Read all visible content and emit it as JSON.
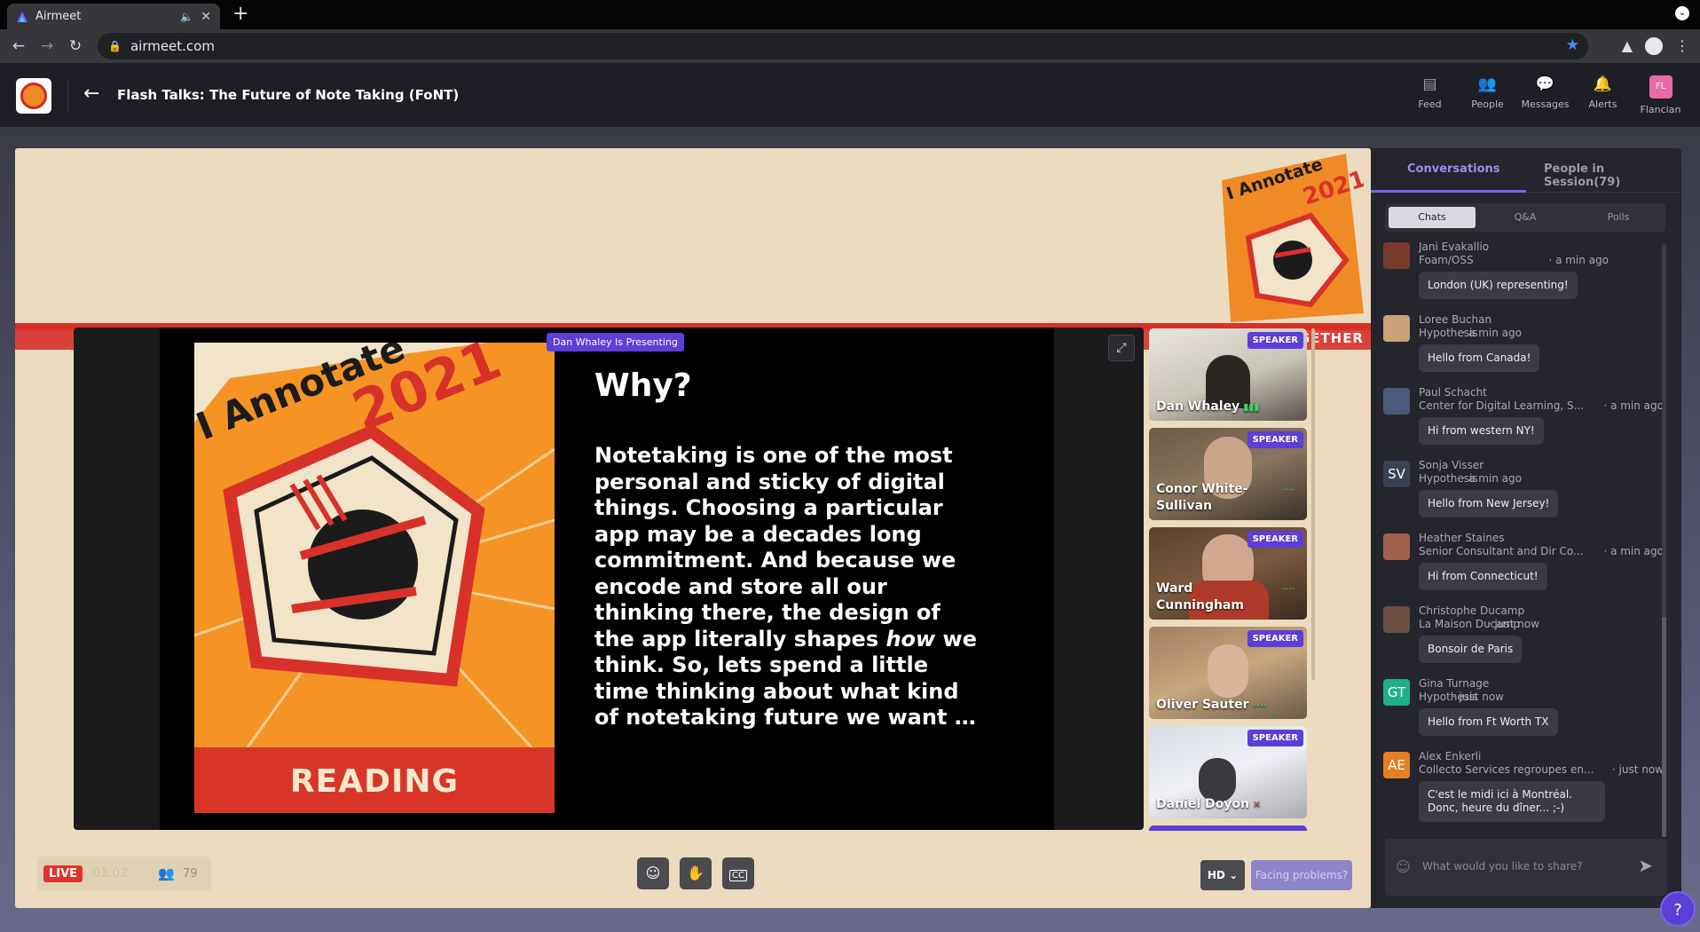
{
  "browser": {
    "tab_title": "Airmeet",
    "url": "airmeet.com",
    "new_tab": "+"
  },
  "header": {
    "session_title": "Flash Talks: The Future of Note Taking (FoNT)",
    "nav": [
      {
        "label": "Feed",
        "icon": "feed-icon"
      },
      {
        "label": "People",
        "icon": "people-icon"
      },
      {
        "label": "Messages",
        "icon": "messages-icon"
      },
      {
        "label": "Alerts",
        "icon": "bell-icon"
      },
      {
        "label": "Flancian",
        "initials": "FL"
      }
    ]
  },
  "stage": {
    "presenting_label": "Dan Whaley Is Presenting",
    "corner_banner_text": "GETHER",
    "slide": {
      "poster_title": "I Annotate",
      "poster_year": "2021",
      "poster_footer": "READING TOGETHER",
      "heading": "Why?",
      "body_before": "Notetaking is one of the most personal and sticky of digital things.  Choosing a particular app may be a decades long commitment.  And because we encode and store all our thinking there, the design of the app literally shapes ",
      "body_em": "how",
      "body_after": " we think.  So, lets spend a little time thinking about what kind of notetaking future we want …"
    },
    "speaker_badge": "SPEAKER",
    "speakers": [
      {
        "name": "Dan Whaley",
        "mic": "active"
      },
      {
        "name": "Conor White-Sullivan",
        "mic": "idle"
      },
      {
        "name": "Ward Cunningham",
        "mic": "idle"
      },
      {
        "name": "Oliver Sauter",
        "mic": "idle"
      },
      {
        "name": "Daniel Doyon",
        "mic": "muted"
      }
    ],
    "live_label": "LIVE",
    "live_time": "03:02",
    "viewer_count": "79",
    "quality": "HD",
    "problems_label": "Facing problems?"
  },
  "panel": {
    "tab_conversations": "Conversations",
    "tab_people": "People in Session(79)",
    "subtab_chats": "Chats",
    "subtab_qa": "Q&A",
    "subtab_polls": "Polls",
    "messages": [
      {
        "name": "Jani Evakallio",
        "org": "Foam/OSS",
        "time": "· a min ago",
        "text": "London (UK) representing!",
        "avatar": "photo",
        "color": "#7a3c2a"
      },
      {
        "name": "Loree Buchan",
        "org": "Hypothesis",
        "time": "· a min ago",
        "text": "Hello from Canada!",
        "avatar": "photo",
        "color": "#c9a27a"
      },
      {
        "name": "Paul Schacht",
        "org": "Center for Digital Learning, S...",
        "time": "· a min ago",
        "text": "Hi from western NY!",
        "avatar": "photo",
        "color": "#4a5a7a"
      },
      {
        "name": "Sonja Visser",
        "org": "Hypothesis",
        "time": "· a min ago",
        "text": "Hello from New Jersey!",
        "avatar": "SV",
        "color": "#3a4152"
      },
      {
        "name": "Heather Staines",
        "org": "Senior Consultant and Dir Co...",
        "time": "· a min ago",
        "text": "Hi from Connecticut!",
        "avatar": "photo",
        "color": "#a0624a"
      },
      {
        "name": "Christophe Ducamp",
        "org": "La Maison Ducamp",
        "time": "· just now",
        "text": "Bonsoir de Paris",
        "avatar": "photo",
        "color": "#6a5040"
      },
      {
        "name": "Gina Turnage",
        "org": "Hypothesis",
        "time": "· just now",
        "text": "Hello from Ft Worth TX",
        "avatar": "GT",
        "color": "#1fb08a"
      },
      {
        "name": "Alex Enkerli",
        "org": "Collecto Services regroupes en...",
        "time": "· just now",
        "text": "C'est le midi ici à Montréal. Donc, heure du dîner... ;-)",
        "avatar": "AE",
        "color": "#e67e22"
      }
    ],
    "compose_placeholder": "What would you like to share?",
    "help_label": "?"
  }
}
